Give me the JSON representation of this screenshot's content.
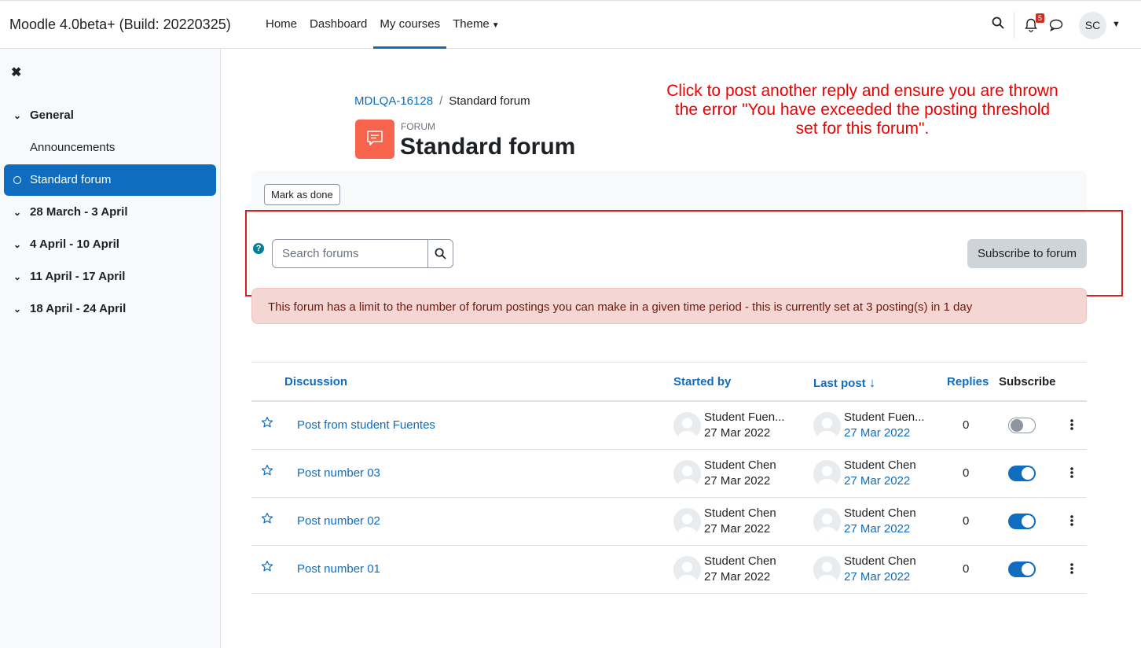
{
  "header": {
    "site_name": "Moodle 4.0beta+ (Build: 20220325)",
    "nav": [
      {
        "label": "Home"
      },
      {
        "label": "Dashboard"
      },
      {
        "label": "My courses"
      },
      {
        "label": "Theme"
      }
    ],
    "active_nav": "My courses",
    "notification_count": "5",
    "user_initials": "SC"
  },
  "sidebar": {
    "items": [
      {
        "label": "General"
      },
      {
        "label": "Announcements"
      },
      {
        "label": "Standard forum"
      },
      {
        "label": "28 March - 3 April"
      },
      {
        "label": "4 April - 10 April"
      },
      {
        "label": "11 April - 17 April"
      },
      {
        "label": "18 April - 24 April"
      }
    ],
    "active_item": "Standard forum"
  },
  "breadcrumb": {
    "course": "MDLQA-16128",
    "current": "Standard forum"
  },
  "page": {
    "activity_type": "Forum",
    "title": "Standard forum",
    "mark_done_label": "Mark as done"
  },
  "annotation": {
    "text": "Click to post another reply and ensure you are thrown the error \"You have exceeded the posting threshold set for this forum\"."
  },
  "search": {
    "placeholder": "Search forums",
    "value": ""
  },
  "subscribe_label": "Subscribe to forum",
  "alert_text": "This forum has a limit to the number of forum postings you can make in a given time period - this is currently set at 3 posting(s) in 1 day",
  "table": {
    "headers": {
      "discussion": "Discussion",
      "started_by": "Started by",
      "last_post": "Last post",
      "replies": "Replies",
      "subscribe": "Subscribe"
    },
    "sort_indicator": "↓",
    "rows": [
      {
        "title": "Post from student Fuentes",
        "started_by": "Student Fuen...",
        "started_date": "27 Mar 2022",
        "last_post_by": "Student Fuen...",
        "last_post_date": "27 Mar 2022",
        "replies": "0",
        "subscribed": false
      },
      {
        "title": "Post number 03",
        "started_by": "Student Chen",
        "started_date": "27 Mar 2022",
        "last_post_by": "Student Chen",
        "last_post_date": "27 Mar 2022",
        "replies": "0",
        "subscribed": true
      },
      {
        "title": "Post number 02",
        "started_by": "Student Chen",
        "started_date": "27 Mar 2022",
        "last_post_by": "Student Chen",
        "last_post_date": "27 Mar 2022",
        "replies": "0",
        "subscribed": true
      },
      {
        "title": "Post number 01",
        "started_by": "Student Chen",
        "started_date": "27 Mar 2022",
        "last_post_by": "Student Chen",
        "last_post_date": "27 Mar 2022",
        "replies": "0",
        "subscribed": true
      }
    ]
  },
  "colors": {
    "primary": "#0f6cbf",
    "forum_icon": "#f7634d",
    "annotation": "#ee0000",
    "alert_bg": "#f4d6d2",
    "frame": "#d62020"
  }
}
